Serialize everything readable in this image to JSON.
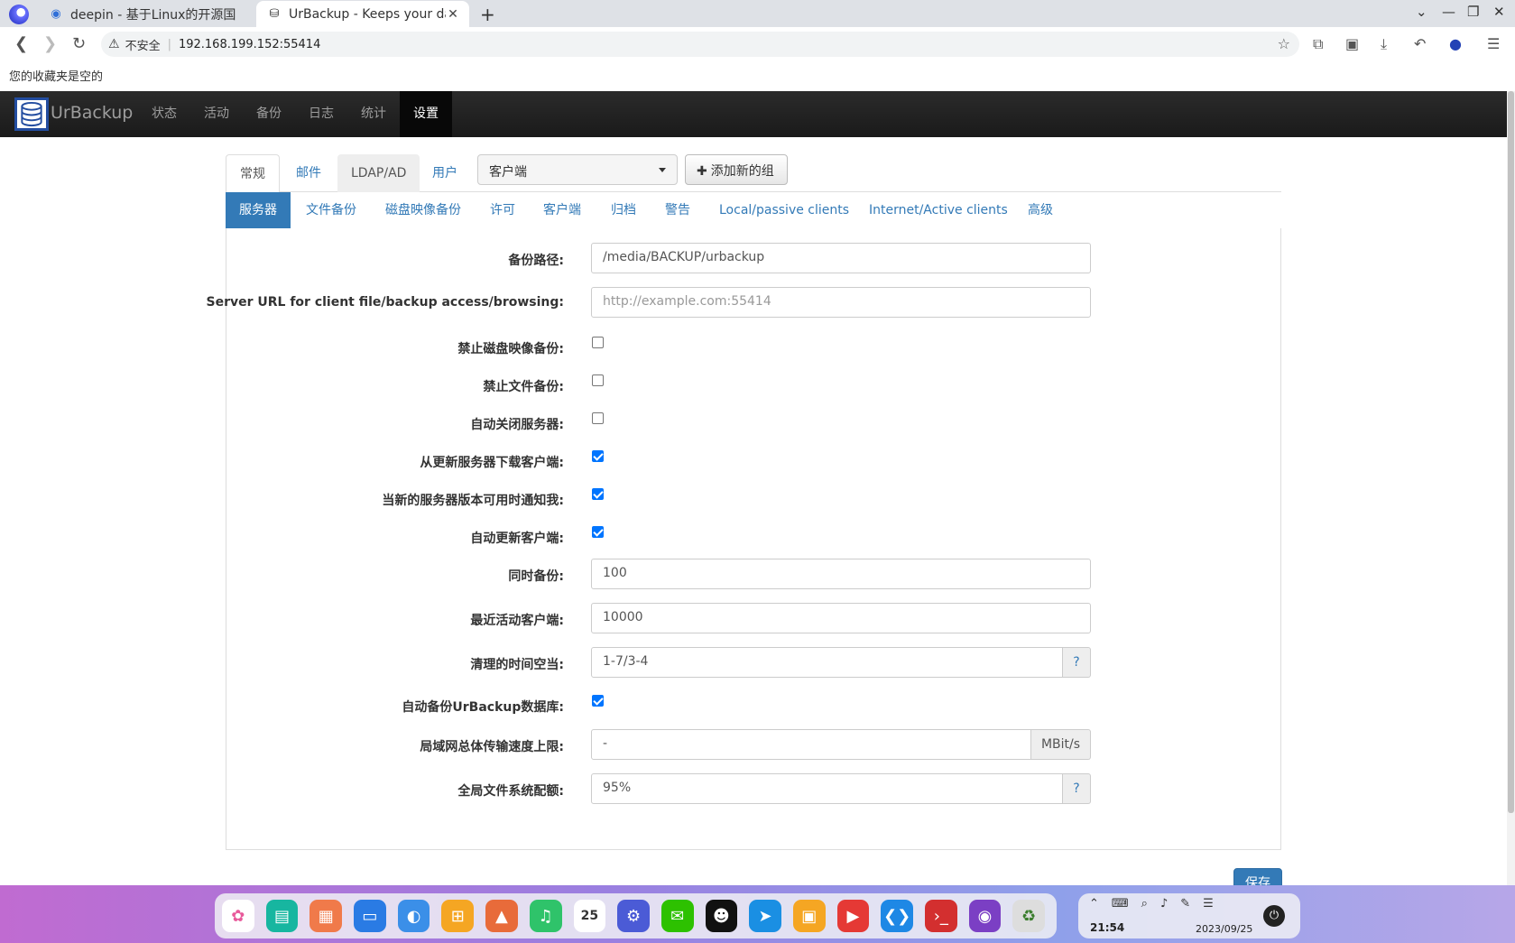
{
  "browser": {
    "tabs": [
      {
        "title": "deepin - 基于Linux的开源国",
        "active": false
      },
      {
        "title": "UrBackup - Keeps your dat",
        "active": true
      }
    ],
    "address": {
      "insecure_label": "不安全",
      "url": "192.168.199.152:55414"
    },
    "bookmarks_text": "您的收藏夹是空的"
  },
  "app": {
    "brand": "UrBackup",
    "nav": [
      "状态",
      "活动",
      "备份",
      "日志",
      "统计",
      "设置"
    ],
    "active_nav": "设置"
  },
  "settings": {
    "tabs": [
      "常规",
      "邮件",
      "LDAP/AD",
      "用户"
    ],
    "group_select": "客户端",
    "add_group_label": "添加新的组",
    "subtabs": [
      "服务器",
      "文件备份",
      "磁盘映像备份",
      "许可",
      "客户端",
      "归档",
      "警告",
      "Local/passive clients",
      "Internet/Active clients",
      "高级"
    ],
    "fields": {
      "backup_path": {
        "label": "备份路径:",
        "value": "/media/BACKUP/urbackup"
      },
      "server_url": {
        "label": "Server URL for client file/backup access/browsing:",
        "placeholder": "http://example.com:55414"
      },
      "disable_image": {
        "label": "禁止磁盘映像备份:",
        "checked": false
      },
      "disable_file": {
        "label": "禁止文件备份:",
        "checked": false
      },
      "auto_shutdown": {
        "label": "自动关闭服务器:",
        "checked": false
      },
      "download_client": {
        "label": "从更新服务器下载客户端:",
        "checked": true
      },
      "notify_new_version": {
        "label": "当新的服务器版本可用时通知我:",
        "checked": true
      },
      "auto_update_clients": {
        "label": "自动更新客户端:",
        "checked": true
      },
      "simultaneous_backups": {
        "label": "同时备份:",
        "value": "100"
      },
      "max_active_clients": {
        "label": "最近活动客户端:",
        "value": "10000"
      },
      "cleanup_window": {
        "label": "清理的时间空当:",
        "value": "1-7/3-4",
        "help": "?"
      },
      "backup_database": {
        "label": "自动备份UrBackup数据库:",
        "checked": true
      },
      "lan_speed_limit": {
        "label": "局域网总体传输速度上限:",
        "value": "-",
        "unit": "MBit/s"
      },
      "global_quota": {
        "label": "全局文件系统配额:",
        "value": "95%",
        "help": "?"
      }
    },
    "save_label": "保存"
  },
  "taskbar": {
    "time": "21:54",
    "date": "2023/09/25",
    "calendar_day": "25"
  }
}
